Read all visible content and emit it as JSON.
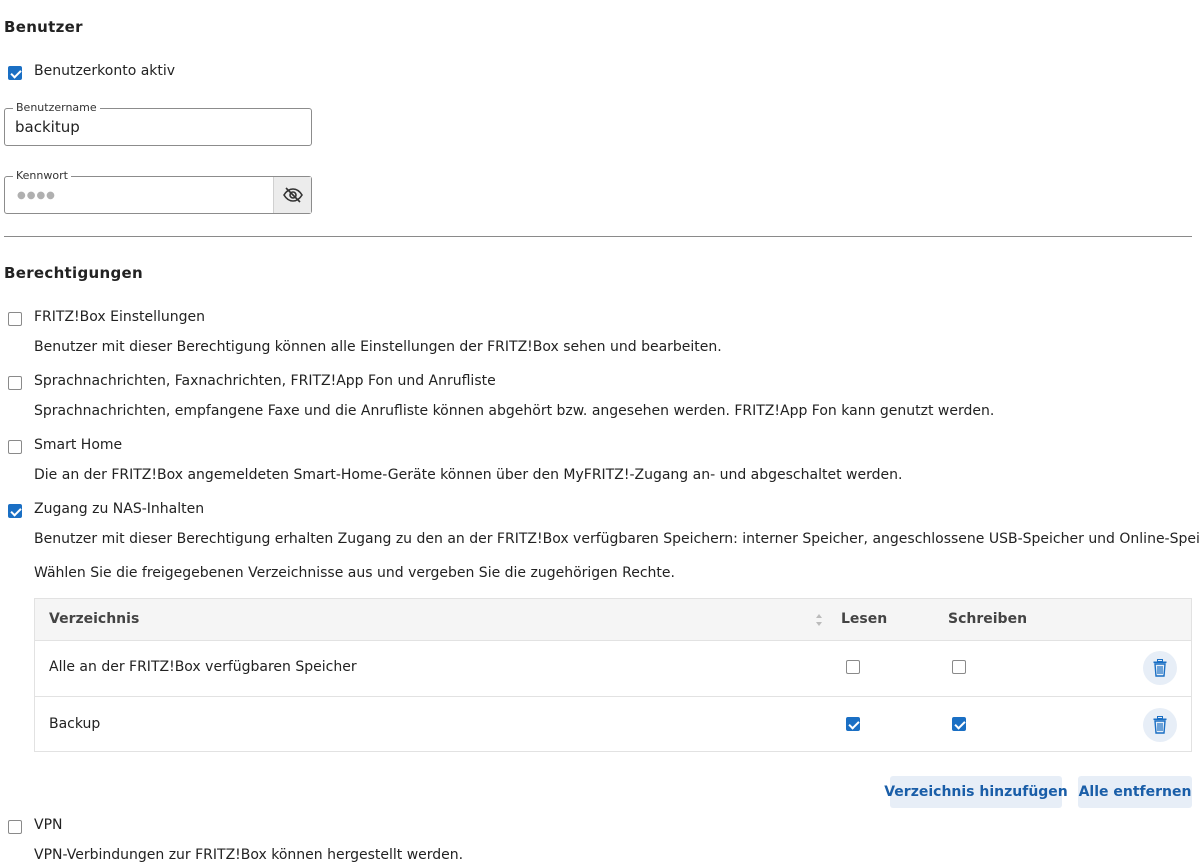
{
  "user_section": {
    "title": "Benutzer",
    "account_active_label": "Benutzerkonto aktiv",
    "account_active_checked": true,
    "username": {
      "legend": "Benutzername",
      "value": "backitup"
    },
    "password": {
      "legend": "Kennwort",
      "masked": "●●●●",
      "toggle_icon": "eye-off-icon"
    }
  },
  "permissions_section": {
    "title": "Berechtigungen",
    "items": [
      {
        "label": "FRITZ!Box Einstellungen",
        "checked": false,
        "description": "Benutzer mit dieser Berechtigung können alle Einstellungen der FRITZ!Box sehen und bearbeiten."
      },
      {
        "label": "Sprachnachrichten, Faxnachrichten, FRITZ!App Fon und Anrufliste",
        "checked": false,
        "description": "Sprachnachrichten, empfangene Faxe und die Anrufliste können abgehört bzw. angesehen werden. FRITZ!App Fon kann genutzt werden."
      },
      {
        "label": "Smart Home",
        "checked": false,
        "description": "Die an der FRITZ!Box angemeldeten Smart-Home-Geräte können über den MyFRITZ!-Zugang an- und abgeschaltet werden."
      },
      {
        "label": "Zugang zu NAS-Inhalten",
        "checked": true,
        "description": "Benutzer mit dieser Berechtigung erhalten Zugang zu den an der FRITZ!Box verfügbaren Speichern: interner Speicher, angeschlossene USB-Speicher und Online-Speicher.",
        "instruction": "Wählen Sie die freigegebenen Verzeichnisse aus und vergeben Sie die zugehörigen Rechte."
      },
      {
        "label": "VPN",
        "checked": false,
        "description": "VPN-Verbindungen zur FRITZ!Box können hergestellt werden."
      }
    ],
    "table": {
      "headers": {
        "directory": "Verzeichnis",
        "read": "Lesen",
        "write": "Schreiben"
      },
      "rows": [
        {
          "directory": "Alle an der FRITZ!Box verfügbaren Speicher",
          "read": false,
          "write": false
        },
        {
          "directory": "Backup",
          "read": true,
          "write": true
        }
      ]
    },
    "buttons": {
      "add_directory": "Verzeichnis hinzufügen",
      "remove_all": "Alle entfernen"
    }
  },
  "colors": {
    "accent": "#1a6fc4",
    "button_bg": "#e7eef7",
    "button_text": "#1a5ea8"
  }
}
